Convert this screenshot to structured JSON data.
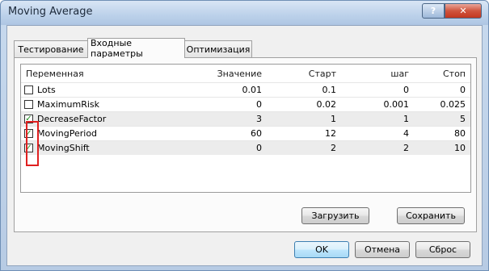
{
  "window": {
    "title": "Moving Average",
    "help_label": "?",
    "close_label": "✕"
  },
  "tabs": [
    {
      "label": "Тестирование"
    },
    {
      "label": "Входные параметры"
    },
    {
      "label": "Оптимизация"
    }
  ],
  "table": {
    "headers": {
      "variable": "Переменная",
      "value": "Значение",
      "start": "Старт",
      "step": "шаг",
      "stop": "Стоп"
    },
    "rows": [
      {
        "name": "Lots",
        "checked": false,
        "check": "",
        "value": "0.01",
        "start": "0.1",
        "step": "0",
        "stop": "0"
      },
      {
        "name": "MaximumRisk",
        "checked": false,
        "check": "",
        "value": "0",
        "start": "0.02",
        "step": "0.001",
        "stop": "0.025"
      },
      {
        "name": "DecreaseFactor",
        "checked": true,
        "check": "✓",
        "value": "3",
        "start": "1",
        "step": "1",
        "stop": "5"
      },
      {
        "name": "MovingPeriod",
        "checked": true,
        "check": "✓",
        "value": "60",
        "start": "12",
        "step": "4",
        "stop": "80"
      },
      {
        "name": "MovingShift",
        "checked": true,
        "check": "✓",
        "value": "0",
        "start": "2",
        "step": "2",
        "stop": "10"
      }
    ]
  },
  "buttons": {
    "load": "Загрузить",
    "save": "Сохранить",
    "ok": "OK",
    "cancel": "Отмена",
    "reset": "Сброс"
  },
  "colors": {
    "highlight": "#e02020",
    "check": "#1a8a1a",
    "close_button": "#c2371f"
  }
}
